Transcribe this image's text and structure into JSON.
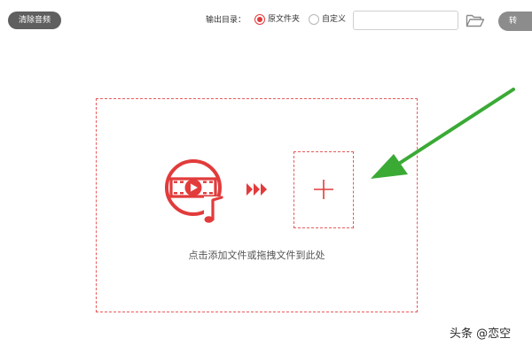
{
  "toolbar": {
    "clear_music_label": "清除音频",
    "output_dir_label": "输出目录：",
    "output_options": [
      {
        "label": "原文件夹",
        "selected": true
      },
      {
        "label": "自定义",
        "selected": false
      }
    ],
    "path_value": "",
    "start_label": "转"
  },
  "drop_zone": {
    "hint": "点击添加文件或拖拽文件到此处"
  },
  "colors": {
    "accent": "#e23b3b",
    "pointer_arrow": "#3aaa35"
  },
  "watermark": "头条 @恋空"
}
